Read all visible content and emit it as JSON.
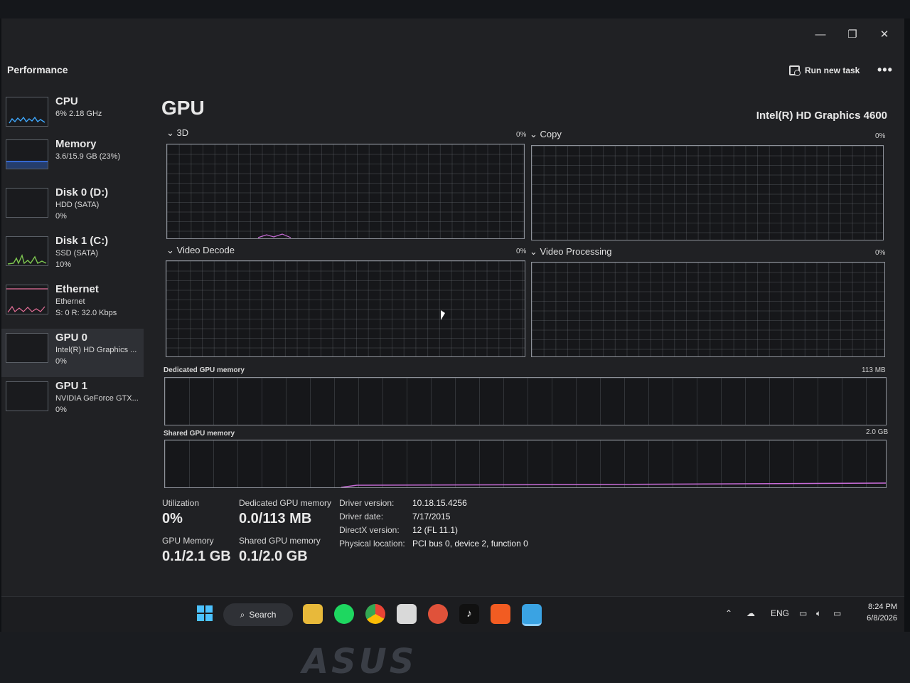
{
  "window": {
    "title": "Performance",
    "run_new_task": "Run new task",
    "more_label": "•••",
    "minimize": "—",
    "maximize": "❐",
    "close": "✕"
  },
  "sidebar": {
    "items": [
      {
        "name": "CPU",
        "sub1": "6% 2.18 GHz",
        "sub2": "",
        "color": "#3fa9ff"
      },
      {
        "name": "Memory",
        "sub1": "3.6/15.9 GB (23%)",
        "sub2": "",
        "color": "#3d7dff"
      },
      {
        "name": "Disk 0 (D:)",
        "sub1": "HDD (SATA)",
        "sub2": "0%",
        "color": "#7ec850"
      },
      {
        "name": "Disk 1 (C:)",
        "sub1": "SSD (SATA)",
        "sub2": "10%",
        "color": "#7ec850"
      },
      {
        "name": "Ethernet",
        "sub1": "Ethernet",
        "sub2": "S: 0 R: 32.0 Kbps",
        "color": "#e8709a"
      },
      {
        "name": "GPU 0",
        "sub1": "Intel(R) HD Graphics ...",
        "sub2": "0%",
        "color": "#c86cd8"
      },
      {
        "name": "GPU 1",
        "sub1": "NVIDIA GeForce GTX...",
        "sub2": "0%",
        "color": "#c86cd8"
      }
    ]
  },
  "main": {
    "title": "GPU",
    "model": "Intel(R) HD Graphics 4600",
    "engines": [
      {
        "label": "3D",
        "pct": "0%"
      },
      {
        "label": "Copy",
        "pct": "0%"
      },
      {
        "label": "Video Decode",
        "pct": "0%"
      },
      {
        "label": "Video Processing",
        "pct": "0%"
      }
    ],
    "dedicated_label": "Dedicated GPU memory",
    "dedicated_max": "113 MB",
    "shared_label": "Shared GPU memory",
    "shared_max": "2.0 GB"
  },
  "stats": {
    "utilization_label": "Utilization",
    "utilization": "0%",
    "dedicated_label": "Dedicated GPU memory",
    "dedicated": "0.0/113 MB",
    "gpu_memory_label": "GPU Memory",
    "gpu_memory": "0.1/2.1 GB",
    "shared_label": "Shared GPU memory",
    "shared": "0.1/2.0 GB"
  },
  "info": {
    "driver_version_label": "Driver version:",
    "driver_version": "10.18.15.4256",
    "driver_date_label": "Driver date:",
    "driver_date": "7/17/2015",
    "directx_label": "DirectX version:",
    "directx": "12 (FL 11.1)",
    "location_label": "Physical location:",
    "location": "PCI bus 0, device 2, function 0"
  },
  "taskbar": {
    "search_label": "Search",
    "language": "ENG",
    "time": "8:24 PM",
    "date": "6/8/2026"
  },
  "brand": "ASUS"
}
